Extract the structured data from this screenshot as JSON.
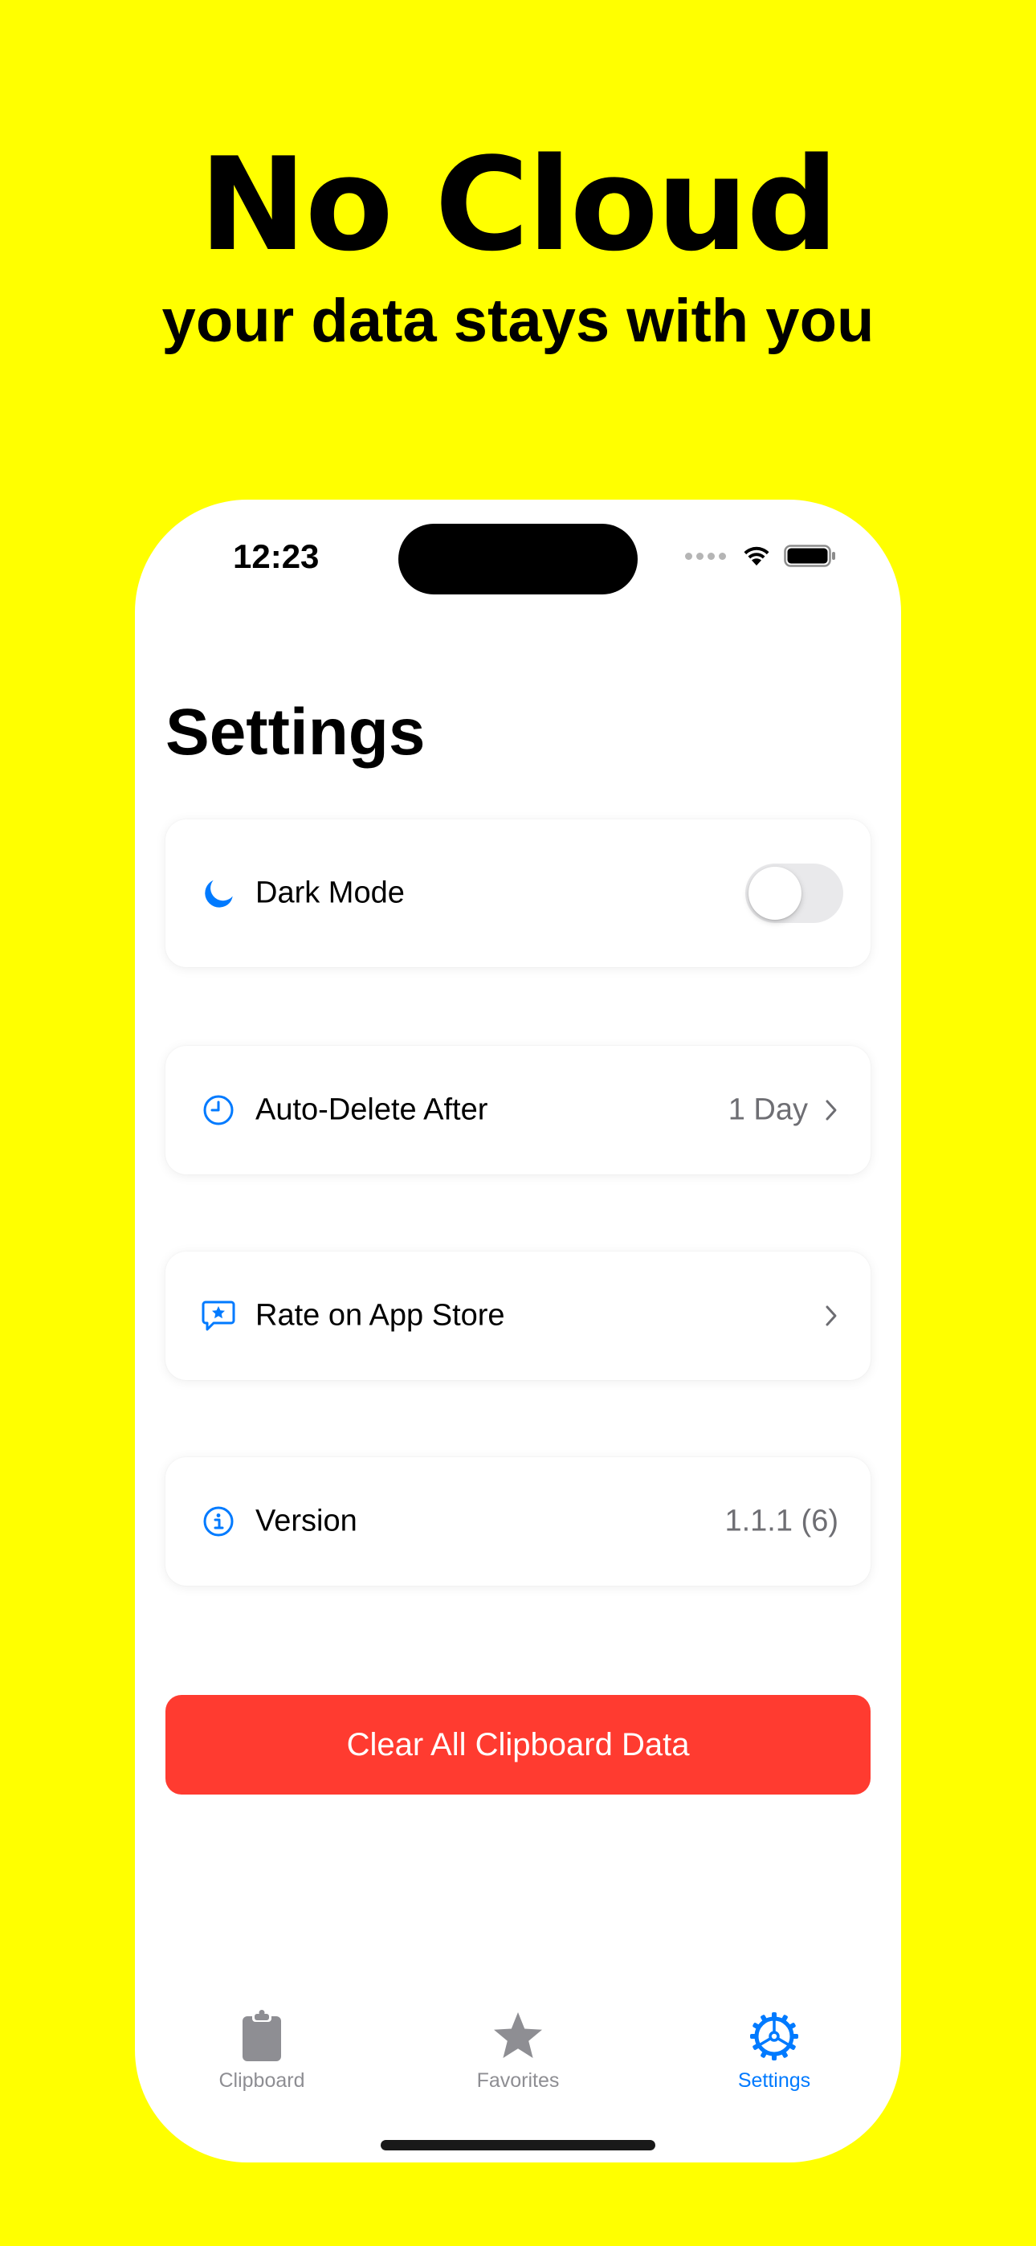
{
  "promo": {
    "headline": "No Cloud",
    "subheadline": "your data stays with you"
  },
  "status_bar": {
    "time": "12:23",
    "icons": [
      "signal-icon",
      "wifi-icon",
      "battery-icon"
    ]
  },
  "page": {
    "title": "Settings"
  },
  "settings": {
    "dark_mode": {
      "icon": "moon-icon",
      "label": "Dark Mode",
      "enabled": false
    },
    "auto_delete": {
      "icon": "clock-icon",
      "label": "Auto-Delete After",
      "value": "1 Day"
    },
    "rate": {
      "icon": "star-bubble-icon",
      "label": "Rate on App Store"
    },
    "version": {
      "icon": "info-icon",
      "label": "Version",
      "value": "1.1.1 (6)"
    },
    "clear_button_label": "Clear All Clipboard Data"
  },
  "tabbar": {
    "tabs": [
      {
        "label": "Clipboard",
        "icon": "clipboard-icon",
        "selected": false
      },
      {
        "label": "Favorites",
        "icon": "star-icon",
        "selected": false
      },
      {
        "label": "Settings",
        "icon": "gear-icon",
        "selected": true
      }
    ]
  },
  "colors": {
    "background": "#FFFF00",
    "accent": "#007AFF",
    "destructive": "#FF3B30",
    "inactive_tab": "#8E8E93"
  }
}
